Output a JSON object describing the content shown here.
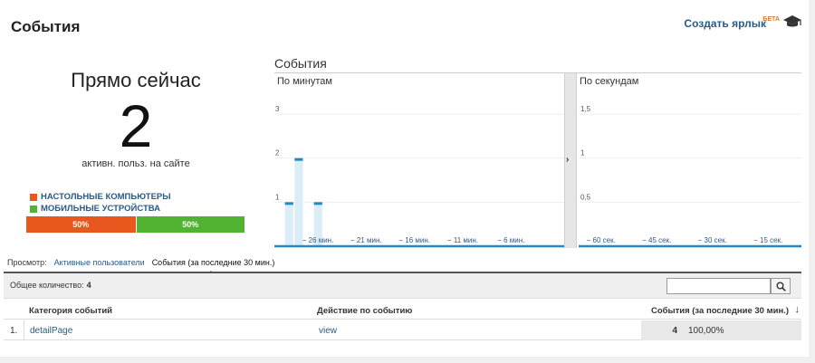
{
  "header": {
    "title": "События",
    "shortcut_label": "Создать ярлык",
    "beta_label": "БЕТА"
  },
  "now": {
    "title": "Прямо сейчас",
    "count": "2",
    "subtitle": "активн. польз. на сайте",
    "legend": [
      {
        "label": "НАСТОЛЬНЫЕ КОМПЬЮТЕРЫ",
        "color": "#e8571e"
      },
      {
        "label": "МОБИЛЬНЫЕ УСТРОЙСТВА",
        "color": "#50b432"
      }
    ],
    "bar": [
      {
        "label": "50%",
        "value": 0.5,
        "color": "#e8571e"
      },
      {
        "label": "50%",
        "value": 0.5,
        "color": "#50b432"
      }
    ]
  },
  "chart": {
    "title": "События",
    "minutes_label": "По минутам",
    "seconds_label": "По секундам"
  },
  "chart_data": [
    {
      "type": "bar",
      "title": "По минутам",
      "ylim": [
        0,
        3
      ],
      "yticks": [
        "3",
        "2",
        "1"
      ],
      "xticks": [
        "− 26 мин.",
        "− 21 мин.",
        "− 16 мин.",
        "− 11 мин.",
        "− 6 мин."
      ],
      "x": [
        -30,
        -29,
        -28,
        -27,
        -26,
        -25,
        -24,
        -23,
        -22,
        -21,
        -20,
        -19,
        -18,
        -17,
        -16,
        -15,
        -14,
        -13,
        -12,
        -11,
        -10,
        -9,
        -8,
        -7,
        -6,
        -5,
        -4,
        -3,
        -2,
        -1
      ],
      "values": [
        0,
        1,
        2,
        0,
        1,
        0,
        0,
        0,
        0,
        0,
        0,
        0,
        0,
        0,
        0,
        0,
        0,
        0,
        0,
        0,
        0,
        0,
        0,
        0,
        0,
        0,
        0,
        0,
        0,
        0
      ],
      "color": "#058dc7"
    },
    {
      "type": "bar",
      "title": "По секундам",
      "ylim": [
        0,
        1.5
      ],
      "yticks": [
        "1,5",
        "1",
        "0,5"
      ],
      "xticks": [
        "− 60 сек.",
        "− 45 сек.",
        "− 30 сек.",
        "− 15 сек."
      ],
      "values": [],
      "color": "#058dc7"
    }
  ],
  "view": {
    "label": "Просмотр:",
    "tabs": [
      "Активные пользователи",
      "События (за последние 30 мин.)"
    ]
  },
  "table": {
    "total_label": "Общее количество:",
    "total_value": "4",
    "search_value": "",
    "columns": [
      "Категория событий",
      "Действие по событию",
      "События (за последние 30 мин.)"
    ],
    "rows": [
      {
        "index": "1.",
        "category": "detailPage",
        "action": "view",
        "count": "4",
        "percent": "100,00%"
      }
    ]
  }
}
